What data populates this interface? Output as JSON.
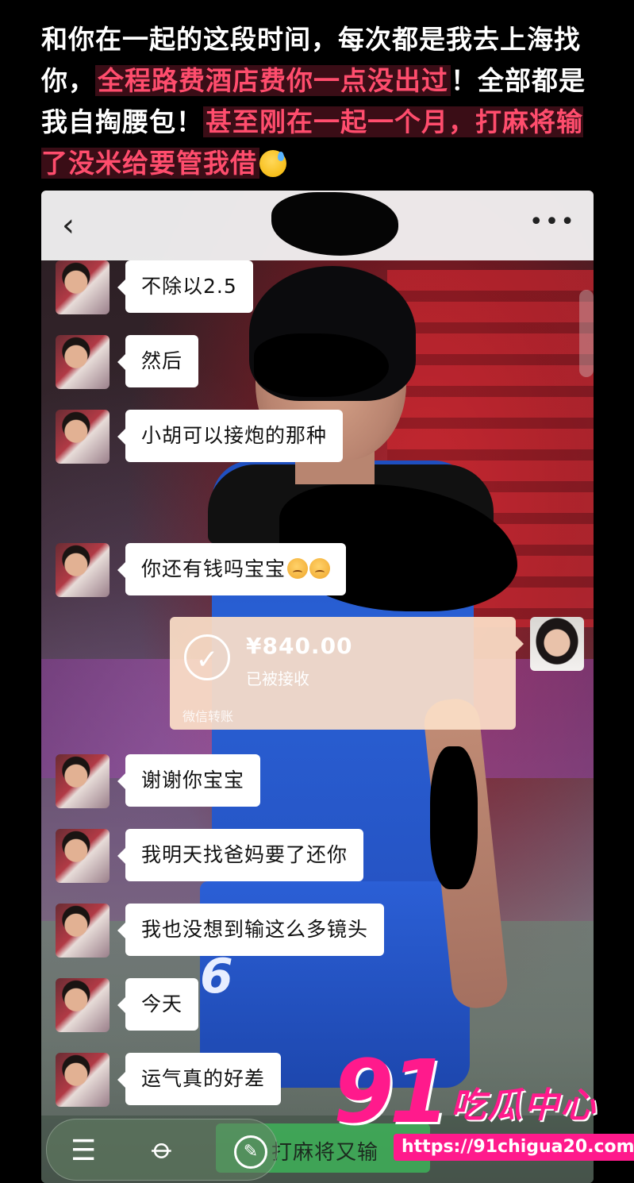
{
  "caption": {
    "part1": "和你在一起的这段时间，每次都是我去上海找你，",
    "highlight1": "全程路费酒店费你一点没出过",
    "part2": "！全部都是我自掏腰包！",
    "highlight2": "甚至刚在一起一个月，打麻将输了没米给要管我借",
    "emoji": "sweat-smile-emoji"
  },
  "chat": {
    "back_icon": "chevron-left-icon",
    "more_icon": "more-dots-icon",
    "messages": [
      {
        "text": "不除以2.5"
      },
      {
        "text": "然后"
      },
      {
        "text": "小胡可以接炮的那种"
      },
      {
        "text": "你还有钱吗宝宝",
        "emoji": "pleading-face-emoji x2"
      },
      {
        "text": "谢谢你宝宝"
      },
      {
        "text": "我明天找爸妈要了还你"
      },
      {
        "text": "我也没想到输这么多镜头"
      },
      {
        "text": "今天"
      },
      {
        "text": "运气真的好差"
      }
    ],
    "transfer": {
      "amount": "¥840.00",
      "status": "已被接收",
      "footer": "微信转账"
    },
    "input": {
      "draft": "打麻将又输"
    }
  },
  "watermark": {
    "number": "91",
    "title": "吃瓜中心",
    "url": "https://91chigua20.com"
  },
  "colors": {
    "highlight": "#ff4d6d",
    "watermark": "#ff1a8c",
    "transfer_bg": "#fce0c8"
  }
}
